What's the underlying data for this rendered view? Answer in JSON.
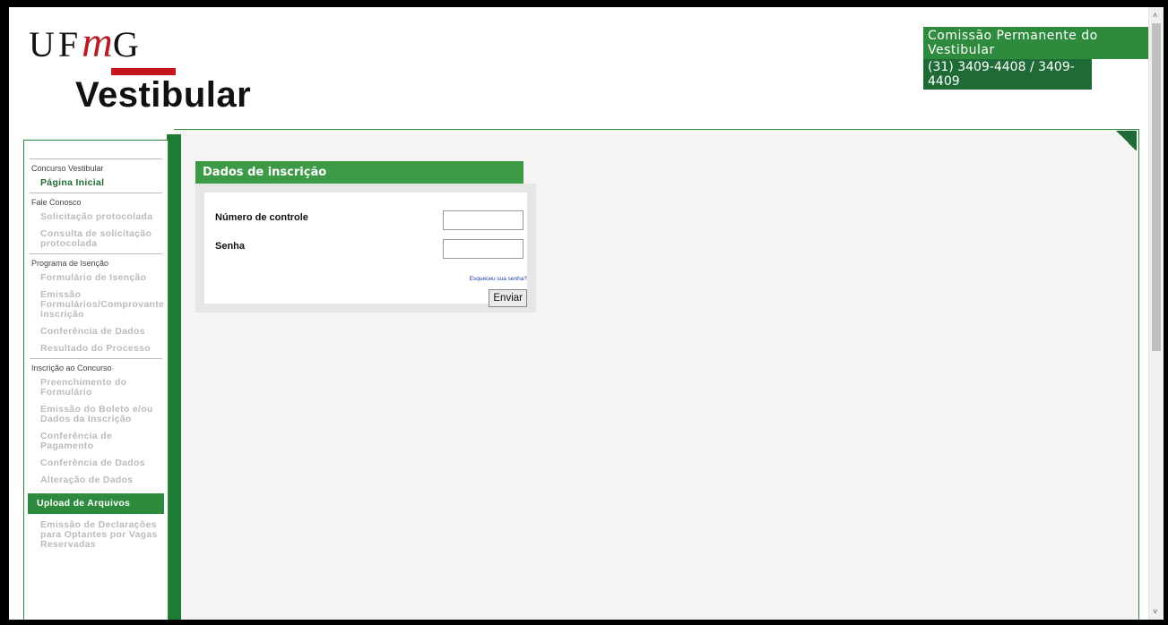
{
  "header": {
    "logo_ufmg_pre": "UF",
    "logo_ufmg_m": "m",
    "logo_ufmg_post": "G",
    "logo_subtitle": "Vestibular",
    "commission": "Comissão Permanente do Vestibular",
    "phone": "(31) 3409-4408 / 3409-4409"
  },
  "sidebar": {
    "sections": [
      {
        "title": "Concurso Vestibular",
        "items": [
          {
            "label": "Página Inicial",
            "state": "active"
          }
        ]
      },
      {
        "title": "Fale Conosco",
        "items": [
          {
            "label": "Solicitação protocolada",
            "state": "disabled"
          },
          {
            "label": "Consulta de solicitação protocolada",
            "state": "disabled"
          }
        ]
      },
      {
        "title": "Programa de Isenção",
        "items": [
          {
            "label": "Formulário de Isenção",
            "state": "disabled"
          },
          {
            "label": "Emissão Formulários/Comprovante Inscrição",
            "state": "disabled"
          },
          {
            "label": "Conferência de Dados",
            "state": "disabled"
          },
          {
            "label": "Resultado do Processo",
            "state": "disabled"
          }
        ]
      },
      {
        "title": "Inscrição ao Concurso",
        "items": [
          {
            "label": "Preenchimento do Formulário",
            "state": "disabled"
          },
          {
            "label": "Emissão do Boleto e/ou Dados da Inscrição",
            "state": "disabled"
          },
          {
            "label": "Conferência de Pagamento",
            "state": "disabled"
          },
          {
            "label": "Conferência de Dados",
            "state": "disabled"
          },
          {
            "label": "Alteração de Dados",
            "state": "disabled"
          },
          {
            "label": "Upload de Arquivos",
            "state": "highlight"
          },
          {
            "label": "Emissão de Declarações para Optantes por Vagas Reservadas",
            "state": "disabled"
          }
        ]
      }
    ]
  },
  "form": {
    "title": "Dados de inscrição",
    "control_label": "Número de controle",
    "control_value": "",
    "password_label": "Senha",
    "password_value": "",
    "forgot_link": "Esqueceu sua senha?",
    "submit_label": "Enviar"
  },
  "colors": {
    "brand_green": "#2e8b3e",
    "dark_green": "#1f6b35",
    "brand_red": "#c4161c"
  }
}
